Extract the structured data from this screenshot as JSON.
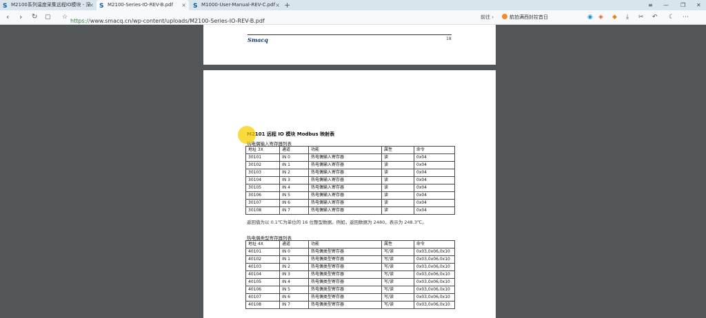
{
  "tabs": [
    {
      "title": "M2100系列温度采集远程IO模块 - 深",
      "close": "×"
    },
    {
      "title": "M2100-Series-IO-REV-B.pdf",
      "close": "×"
    },
    {
      "title": "M1000-User-Manual-REV-C.pdf",
      "close": "×"
    }
  ],
  "new_tab": "+",
  "window_controls": {
    "menu": "≡",
    "min": "—",
    "restore": "❐",
    "close": "✕"
  },
  "toolbar": {
    "back": "‹",
    "forward": "›",
    "reload": "↻",
    "reader": "▢",
    "star": "☆",
    "url_scheme": "https://",
    "url_rest": "www.smacq.cn/wp-content/uploads/M2100-Series-IO-REV-B.pdf",
    "go": "前往",
    "go_arrow": "›",
    "search_text": "航拍满西封控首日",
    "search_icon": "search-icon"
  },
  "colors": {
    "viewer_bg": "#525659",
    "url_scheme": "#2f7a3a",
    "cursor_highlight": "#f8ce00"
  },
  "page_header": {
    "brand": "Smacq",
    "page_number": "18"
  },
  "doc": {
    "title": "M2101 远程 IO 模块  Modbus 映射表",
    "table1": {
      "caption": "热电偶输入寄存器列表",
      "headers": [
        "地址  3X",
        "通道",
        "功能",
        "属性",
        "命令"
      ],
      "rows": [
        [
          "30101",
          "IN 0",
          "热电偶输入寄存器",
          "读",
          "0x04"
        ],
        [
          "30102",
          "IN 1",
          "热电偶输入寄存器",
          "读",
          "0x04"
        ],
        [
          "30103",
          "IN 2",
          "热电偶输入寄存器",
          "读",
          "0x04"
        ],
        [
          "30104",
          "IN 3",
          "热电偶输入寄存器",
          "读",
          "0x04"
        ],
        [
          "30105",
          "IN 4",
          "热电偶输入寄存器",
          "读",
          "0x04"
        ],
        [
          "30106",
          "IN 5",
          "热电偶输入寄存器",
          "读",
          "0x04"
        ],
        [
          "30107",
          "IN 6",
          "热电偶输入寄存器",
          "读",
          "0x04"
        ],
        [
          "30108",
          "IN 7",
          "热电偶输入寄存器",
          "读",
          "0x04"
        ]
      ],
      "note": "返回值为以 0.1℃为单位的 16 位整型数据。例如，返回数据为 2480，表示为 248.3℃。"
    },
    "table2": {
      "caption": "热电偶类型寄存器列表",
      "headers": [
        "地址  4X",
        "通道",
        "功能",
        "属性",
        "命令"
      ],
      "rows": [
        [
          "40101",
          "IN 0",
          "热电偶类型寄存器",
          "写/读",
          "0x03,0x06,0x10"
        ],
        [
          "40102",
          "IN 1",
          "热电偶类型寄存器",
          "写/读",
          "0x03,0x06,0x10"
        ],
        [
          "40103",
          "IN 2",
          "热电偶类型寄存器",
          "写/读",
          "0x03,0x06,0x10"
        ],
        [
          "40104",
          "IN 3",
          "热电偶类型寄存器",
          "写/读",
          "0x03,0x06,0x10"
        ],
        [
          "40105",
          "IN 4",
          "热电偶类型寄存器",
          "写/读",
          "0x03,0x06,0x10"
        ],
        [
          "40106",
          "IN 5",
          "热电偶类型寄存器",
          "写/读",
          "0x03,0x06,0x10"
        ],
        [
          "40107",
          "IN 6",
          "热电偶类型寄存器",
          "写/读",
          "0x03,0x06,0x10"
        ],
        [
          "40108",
          "IN 7",
          "热电偶类型寄存器",
          "写/读",
          "0x03,0x06,0x10"
        ]
      ]
    }
  }
}
